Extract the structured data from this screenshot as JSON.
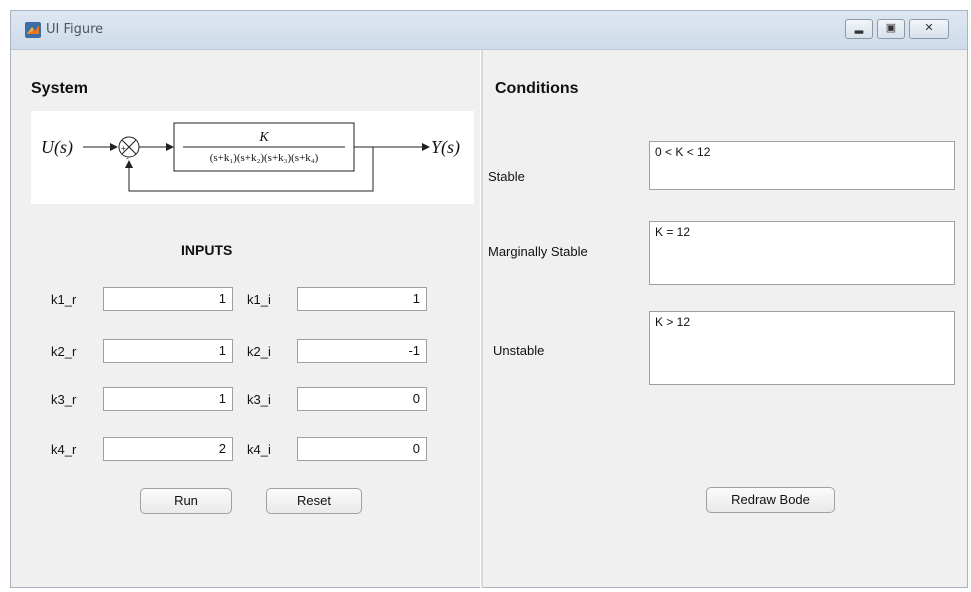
{
  "window": {
    "title": "UI Figure",
    "minimize_icon": "minimize-icon",
    "maximize_icon": "maximize-icon",
    "close_icon": "close-icon"
  },
  "left_panel": {
    "title": "System",
    "diagram": {
      "input": "U(s)",
      "output": "Y(s)",
      "numerator": "K",
      "denominator": "(s+k₁)(s+k₂)(s+k₃)(s+k₄)"
    },
    "inputs_title": "INPUTS",
    "rows": [
      {
        "r_label": "k1_r",
        "r_value": "1",
        "i_label": "k1_i",
        "i_value": "1"
      },
      {
        "r_label": "k2_r",
        "r_value": "1",
        "i_label": "k2_i",
        "i_value": "-1"
      },
      {
        "r_label": "k3_r",
        "r_value": "1",
        "i_label": "k3_i",
        "i_value": "0"
      },
      {
        "r_label": "k4_r",
        "r_value": "2",
        "i_label": "k4_i",
        "i_value": "0"
      }
    ],
    "run_label": "Run",
    "reset_label": "Reset"
  },
  "right_panel": {
    "title": "Conditions",
    "stable_label": "Stable",
    "stable_value": "0 < K < 12",
    "marginal_label": "Marginally Stable",
    "marginal_value": "K = 12",
    "unstable_label": "Unstable",
    "unstable_value": "K > 12",
    "redraw_label": "Redraw Bode"
  }
}
